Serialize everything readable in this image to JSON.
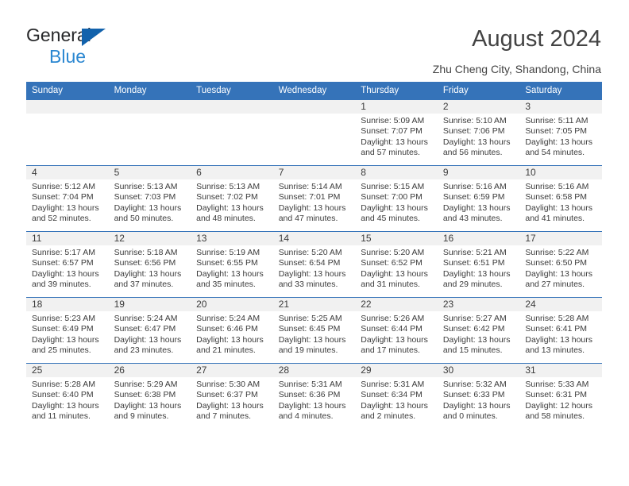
{
  "brand": {
    "name_part1": "General",
    "name_part2": "Blue",
    "triangle_color": "#1262ac",
    "blue_text_color": "#2b87d1"
  },
  "header": {
    "title": "August 2024",
    "subtitle": "Zhu Cheng City, Shandong, China"
  },
  "theme": {
    "header_row_bg": "#3573b9",
    "header_row_text": "#ffffff",
    "daynum_band_bg": "#f1f1f1",
    "cell_border": "#3573b9",
    "body_text": "#3b3b3b"
  },
  "weekdays": [
    "Sunday",
    "Monday",
    "Tuesday",
    "Wednesday",
    "Thursday",
    "Friday",
    "Saturday"
  ],
  "weeks": [
    [
      {
        "day": "",
        "sunrise": "",
        "sunset": "",
        "daylight": "",
        "empty": true
      },
      {
        "day": "",
        "sunrise": "",
        "sunset": "",
        "daylight": "",
        "empty": true
      },
      {
        "day": "",
        "sunrise": "",
        "sunset": "",
        "daylight": "",
        "empty": true
      },
      {
        "day": "",
        "sunrise": "",
        "sunset": "",
        "daylight": "",
        "empty": true
      },
      {
        "day": "1",
        "sunrise": "Sunrise: 5:09 AM",
        "sunset": "Sunset: 7:07 PM",
        "daylight": "Daylight: 13 hours and 57 minutes.",
        "empty": false
      },
      {
        "day": "2",
        "sunrise": "Sunrise: 5:10 AM",
        "sunset": "Sunset: 7:06 PM",
        "daylight": "Daylight: 13 hours and 56 minutes.",
        "empty": false
      },
      {
        "day": "3",
        "sunrise": "Sunrise: 5:11 AM",
        "sunset": "Sunset: 7:05 PM",
        "daylight": "Daylight: 13 hours and 54 minutes.",
        "empty": false
      }
    ],
    [
      {
        "day": "4",
        "sunrise": "Sunrise: 5:12 AM",
        "sunset": "Sunset: 7:04 PM",
        "daylight": "Daylight: 13 hours and 52 minutes.",
        "empty": false
      },
      {
        "day": "5",
        "sunrise": "Sunrise: 5:13 AM",
        "sunset": "Sunset: 7:03 PM",
        "daylight": "Daylight: 13 hours and 50 minutes.",
        "empty": false
      },
      {
        "day": "6",
        "sunrise": "Sunrise: 5:13 AM",
        "sunset": "Sunset: 7:02 PM",
        "daylight": "Daylight: 13 hours and 48 minutes.",
        "empty": false
      },
      {
        "day": "7",
        "sunrise": "Sunrise: 5:14 AM",
        "sunset": "Sunset: 7:01 PM",
        "daylight": "Daylight: 13 hours and 47 minutes.",
        "empty": false
      },
      {
        "day": "8",
        "sunrise": "Sunrise: 5:15 AM",
        "sunset": "Sunset: 7:00 PM",
        "daylight": "Daylight: 13 hours and 45 minutes.",
        "empty": false
      },
      {
        "day": "9",
        "sunrise": "Sunrise: 5:16 AM",
        "sunset": "Sunset: 6:59 PM",
        "daylight": "Daylight: 13 hours and 43 minutes.",
        "empty": false
      },
      {
        "day": "10",
        "sunrise": "Sunrise: 5:16 AM",
        "sunset": "Sunset: 6:58 PM",
        "daylight": "Daylight: 13 hours and 41 minutes.",
        "empty": false
      }
    ],
    [
      {
        "day": "11",
        "sunrise": "Sunrise: 5:17 AM",
        "sunset": "Sunset: 6:57 PM",
        "daylight": "Daylight: 13 hours and 39 minutes.",
        "empty": false
      },
      {
        "day": "12",
        "sunrise": "Sunrise: 5:18 AM",
        "sunset": "Sunset: 6:56 PM",
        "daylight": "Daylight: 13 hours and 37 minutes.",
        "empty": false
      },
      {
        "day": "13",
        "sunrise": "Sunrise: 5:19 AM",
        "sunset": "Sunset: 6:55 PM",
        "daylight": "Daylight: 13 hours and 35 minutes.",
        "empty": false
      },
      {
        "day": "14",
        "sunrise": "Sunrise: 5:20 AM",
        "sunset": "Sunset: 6:54 PM",
        "daylight": "Daylight: 13 hours and 33 minutes.",
        "empty": false
      },
      {
        "day": "15",
        "sunrise": "Sunrise: 5:20 AM",
        "sunset": "Sunset: 6:52 PM",
        "daylight": "Daylight: 13 hours and 31 minutes.",
        "empty": false
      },
      {
        "day": "16",
        "sunrise": "Sunrise: 5:21 AM",
        "sunset": "Sunset: 6:51 PM",
        "daylight": "Daylight: 13 hours and 29 minutes.",
        "empty": false
      },
      {
        "day": "17",
        "sunrise": "Sunrise: 5:22 AM",
        "sunset": "Sunset: 6:50 PM",
        "daylight": "Daylight: 13 hours and 27 minutes.",
        "empty": false
      }
    ],
    [
      {
        "day": "18",
        "sunrise": "Sunrise: 5:23 AM",
        "sunset": "Sunset: 6:49 PM",
        "daylight": "Daylight: 13 hours and 25 minutes.",
        "empty": false
      },
      {
        "day": "19",
        "sunrise": "Sunrise: 5:24 AM",
        "sunset": "Sunset: 6:47 PM",
        "daylight": "Daylight: 13 hours and 23 minutes.",
        "empty": false
      },
      {
        "day": "20",
        "sunrise": "Sunrise: 5:24 AM",
        "sunset": "Sunset: 6:46 PM",
        "daylight": "Daylight: 13 hours and 21 minutes.",
        "empty": false
      },
      {
        "day": "21",
        "sunrise": "Sunrise: 5:25 AM",
        "sunset": "Sunset: 6:45 PM",
        "daylight": "Daylight: 13 hours and 19 minutes.",
        "empty": false
      },
      {
        "day": "22",
        "sunrise": "Sunrise: 5:26 AM",
        "sunset": "Sunset: 6:44 PM",
        "daylight": "Daylight: 13 hours and 17 minutes.",
        "empty": false
      },
      {
        "day": "23",
        "sunrise": "Sunrise: 5:27 AM",
        "sunset": "Sunset: 6:42 PM",
        "daylight": "Daylight: 13 hours and 15 minutes.",
        "empty": false
      },
      {
        "day": "24",
        "sunrise": "Sunrise: 5:28 AM",
        "sunset": "Sunset: 6:41 PM",
        "daylight": "Daylight: 13 hours and 13 minutes.",
        "empty": false
      }
    ],
    [
      {
        "day": "25",
        "sunrise": "Sunrise: 5:28 AM",
        "sunset": "Sunset: 6:40 PM",
        "daylight": "Daylight: 13 hours and 11 minutes.",
        "empty": false
      },
      {
        "day": "26",
        "sunrise": "Sunrise: 5:29 AM",
        "sunset": "Sunset: 6:38 PM",
        "daylight": "Daylight: 13 hours and 9 minutes.",
        "empty": false
      },
      {
        "day": "27",
        "sunrise": "Sunrise: 5:30 AM",
        "sunset": "Sunset: 6:37 PM",
        "daylight": "Daylight: 13 hours and 7 minutes.",
        "empty": false
      },
      {
        "day": "28",
        "sunrise": "Sunrise: 5:31 AM",
        "sunset": "Sunset: 6:36 PM",
        "daylight": "Daylight: 13 hours and 4 minutes.",
        "empty": false
      },
      {
        "day": "29",
        "sunrise": "Sunrise: 5:31 AM",
        "sunset": "Sunset: 6:34 PM",
        "daylight": "Daylight: 13 hours and 2 minutes.",
        "empty": false
      },
      {
        "day": "30",
        "sunrise": "Sunrise: 5:32 AM",
        "sunset": "Sunset: 6:33 PM",
        "daylight": "Daylight: 13 hours and 0 minutes.",
        "empty": false
      },
      {
        "day": "31",
        "sunrise": "Sunrise: 5:33 AM",
        "sunset": "Sunset: 6:31 PM",
        "daylight": "Daylight: 12 hours and 58 minutes.",
        "empty": false
      }
    ]
  ]
}
